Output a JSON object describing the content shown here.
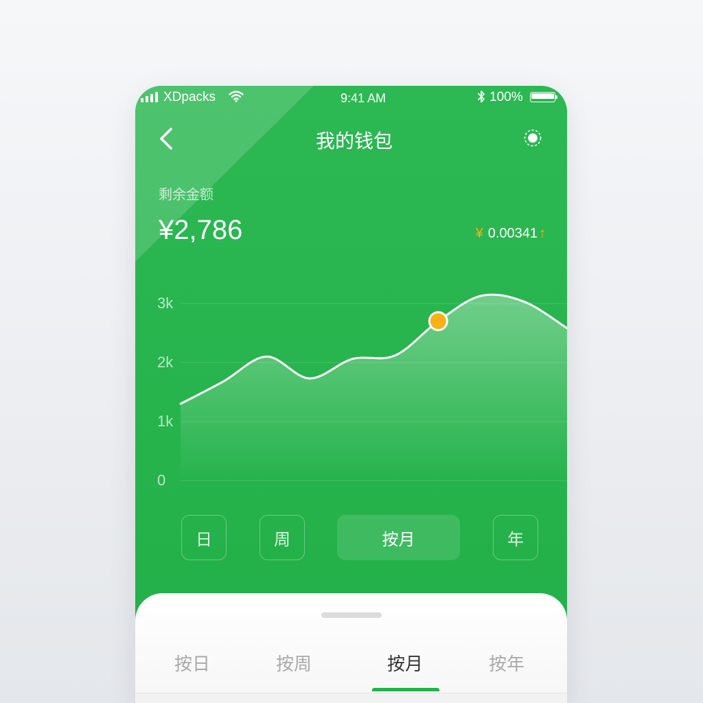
{
  "status_bar": {
    "carrier": "XDpacks",
    "time": "9:41 AM",
    "battery_percent": "100%",
    "battery_level": 1.0
  },
  "nav": {
    "title": "我的钱包"
  },
  "balance": {
    "label": "剩余金额",
    "amount": "¥2,786",
    "change": {
      "currency": "¥",
      "value": "0.00341",
      "arrow": "↑"
    }
  },
  "period_buttons": [
    {
      "label": "日",
      "selected": false
    },
    {
      "label": "周",
      "selected": false
    },
    {
      "label": "按月",
      "selected": true
    },
    {
      "label": "年",
      "selected": false
    }
  ],
  "sheet_tabs": [
    {
      "label": "按日",
      "selected": false
    },
    {
      "label": "按周",
      "selected": false
    },
    {
      "label": "按月",
      "selected": true
    },
    {
      "label": "按年",
      "selected": false
    }
  ],
  "colors": {
    "primary_green": "#22b24a",
    "accent_yellow": "#f9b115",
    "tab_inactive": "#a9a9a9",
    "tab_active": "#333333"
  },
  "icons": {
    "signal": "signal-bars-icon",
    "wifi": "wifi-icon",
    "bluetooth": "bluetooth-icon",
    "battery": "battery-icon",
    "back": "chevron-left-icon",
    "action": "target-icon"
  },
  "chart_data": {
    "type": "line",
    "smooth": true,
    "area_fill": true,
    "values": [
      1300,
      1680,
      2100,
      1730,
      2060,
      2120,
      2700,
      3130,
      3030,
      2580
    ],
    "highlight_index": 6,
    "yticks": [
      0,
      1000,
      2000,
      3000
    ],
    "ytick_labels": [
      "0",
      "1k",
      "2k",
      "3k"
    ],
    "ylim": [
      0,
      3000
    ],
    "grid": true,
    "legend": "none"
  }
}
